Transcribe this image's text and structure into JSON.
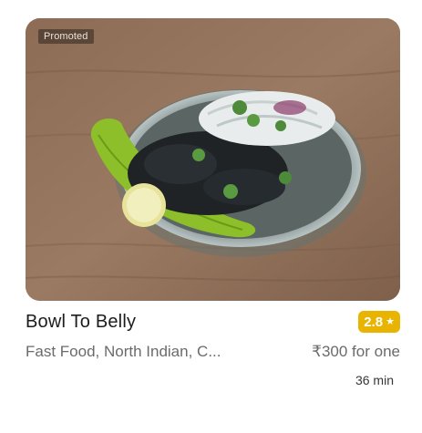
{
  "card": {
    "badge": "Promoted",
    "name": "Bowl To Belly",
    "rating": "2.8",
    "rating_icon": "star-icon",
    "cuisines": "Fast Food, North Indian, C...",
    "price": "₹300 for one",
    "delivery_time": "36 min",
    "colors": {
      "rating_badge": "#e8b400",
      "title": "#1c1c1c",
      "secondary_text": "#6b6b6b"
    }
  }
}
